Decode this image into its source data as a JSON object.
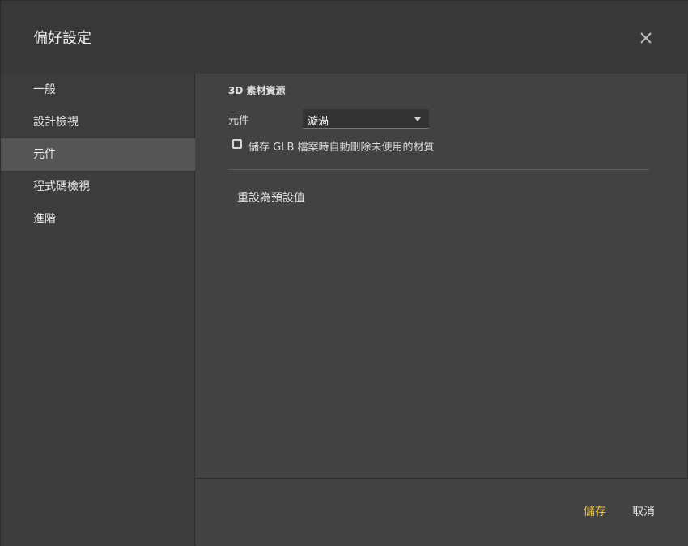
{
  "dialog": {
    "title": "偏好設定",
    "close_icon": "close-icon"
  },
  "sidebar": {
    "items": [
      {
        "label": "一般",
        "active": false
      },
      {
        "label": "設計檢視",
        "active": false
      },
      {
        "label": "元件",
        "active": true
      },
      {
        "label": "程式碼檢視",
        "active": false
      },
      {
        "label": "進階",
        "active": false
      }
    ]
  },
  "main": {
    "section_title": "3D 素材資源",
    "component_label": "元件",
    "component_select_value": "漩渦",
    "checkbox_label": "儲存 GLB 檔案時自動刪除未使用的材質",
    "checkbox_checked": false,
    "reset_label": "重設為預設值"
  },
  "footer": {
    "save_label": "儲存",
    "cancel_label": "取消"
  },
  "colors": {
    "accent": "#f1c232",
    "header_bg": "#383838",
    "panel_bg": "#424242",
    "sidebar_active_bg": "#555555"
  }
}
